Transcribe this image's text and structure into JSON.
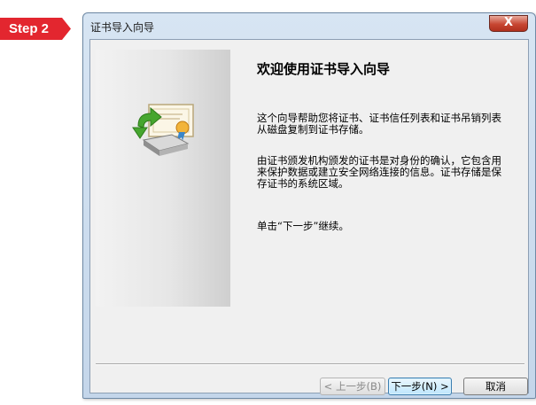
{
  "step_badge": "Step 2",
  "window": {
    "title": "证书导入向导",
    "close_label": "X"
  },
  "wizard": {
    "heading": "欢迎使用证书导入向导",
    "paragraph1": "这个向导帮助您将证书、证书信任列表和证书吊销列表从磁盘复制到证书存储。",
    "paragraph2": "由证书颁发机构颁发的证书是对身份的确认，它包含用来保护数据或建立安全网络连接的信息。证书存储是保存证书的系统区域。",
    "paragraph3": "单击“下一步”继续。"
  },
  "buttons": {
    "back": "< 上一步(B)",
    "next": "下一步(N) >",
    "cancel": "取消"
  },
  "icons": {
    "wizard_art": "certificate-import-icon",
    "close": "close-icon"
  },
  "colors": {
    "badge": "#e3262f",
    "close_button": "#c74632"
  }
}
